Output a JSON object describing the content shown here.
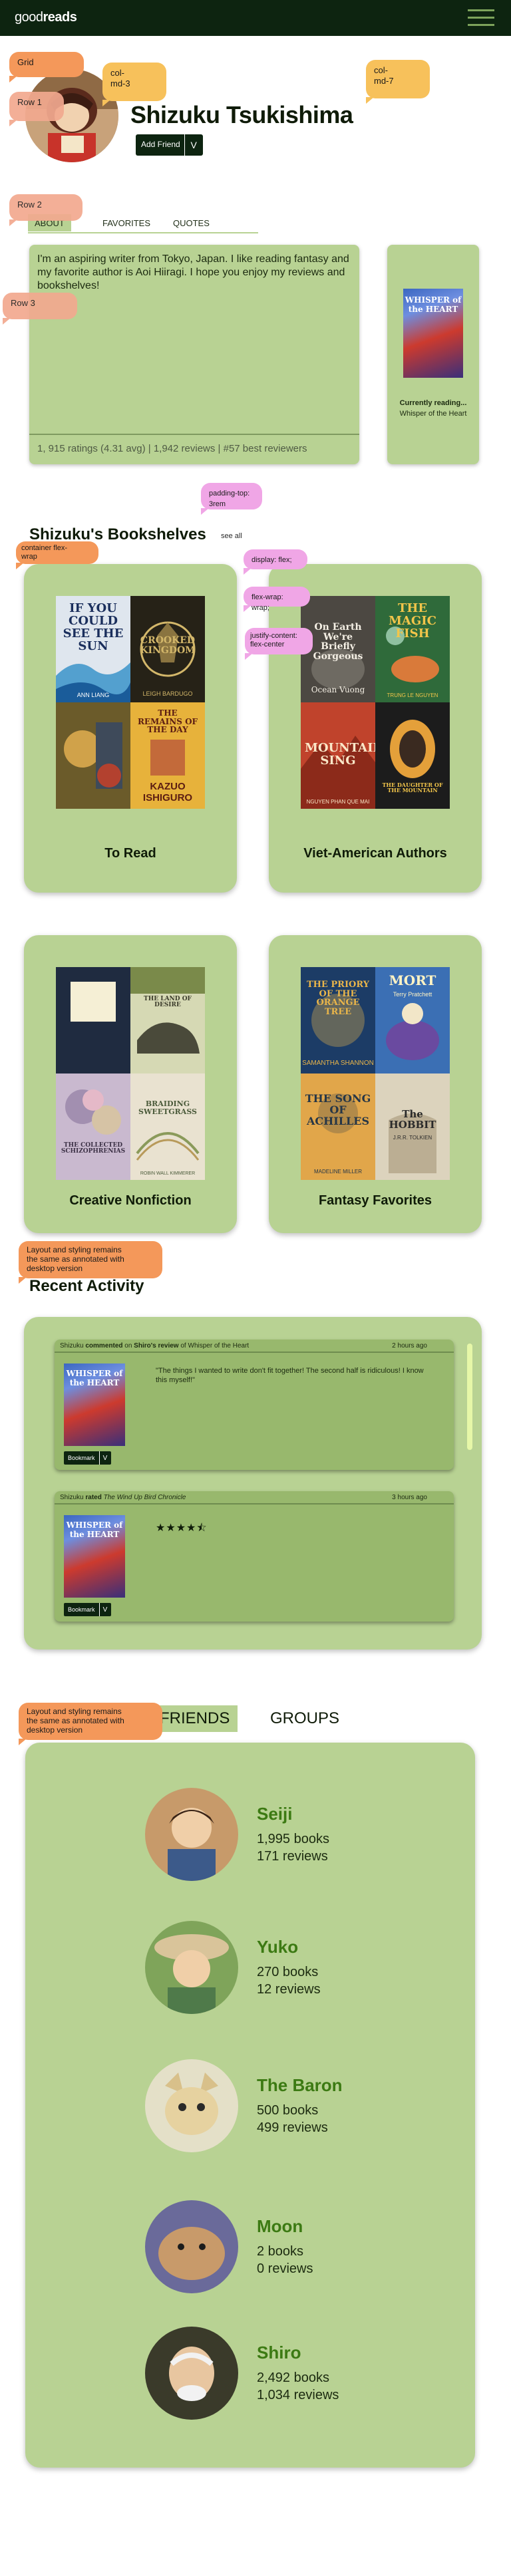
{
  "nav": {
    "logo_regular": "good",
    "logo_bold": "reads"
  },
  "notes": {
    "grid": "Grid",
    "row1": "Row 1",
    "col_md_3": "col-\nmd-3",
    "col_md_7": "col-\nmd-7",
    "row2": "Row 2",
    "row3": "Row 3",
    "padding_top": "padding-top:\n3rem",
    "container_flex_wrap": "container flex-\nwrap",
    "display_flex": "display: flex;",
    "flex_wrap": "flex-wrap: wrap;",
    "justify_content": "justify-content:\nflex-center",
    "layout_same_1": "Layout and styling remains\nthe same as annotated with\ndesktop version",
    "layout_same_2": "Layout and styling remains\nthe same as annotated with\ndesktop version"
  },
  "profile": {
    "name": "Shizuku Tsukishima",
    "add_friend": "Add Friend",
    "add_friend_chevron": "V",
    "tabs": [
      "ABOUT",
      "FAVORITES",
      "QUOTES"
    ],
    "about": "I'm an aspiring writer from Tokyo, Japan. I like reading fantasy and my favorite author is Aoi Hiiragi. I hope you enjoy my reviews and bookshelves!",
    "stats": "1, 915 ratings (4.31 avg)  |  1,942 reviews  |  #57 best reviewers",
    "currently_reading_label": "Currently reading...",
    "currently_reading_title": "Whisper of the Heart",
    "cover_text": "WHISPER of the HEART"
  },
  "bookshelves": {
    "title": "Shizuku's Bookshelves",
    "see_all": "see all",
    "shelves": [
      {
        "name": "To Read",
        "books": [
          {
            "title": "IF YOU COULD SEE THE SUN",
            "author": "ANN LIANG",
            "bg": "#dfe6ee",
            "fg": "#1a2e5c"
          },
          {
            "title": "CROOKED KINGDOM",
            "author": "LEIGH BARDUGO",
            "bg": "#262217",
            "fg": "#d3b76a"
          },
          {
            "title": "",
            "author": "",
            "bg": "#7a6a38",
            "fg": "#f1d89a"
          },
          {
            "title": "THE REMAINS OF THE DAY",
            "author": "KAZUO ISHIGURO",
            "bg": "#e7b23b",
            "fg": "#5c1d12"
          }
        ]
      },
      {
        "name": "Viet-American Authors",
        "books": [
          {
            "title": "On Earth We're Briefly Gorgeous",
            "author": "Ocean Vuong",
            "bg": "#5f5a52",
            "fg": "#f4efe4"
          },
          {
            "title": "THE MAGIC FISH",
            "author": "TRUNG LE NGUYEN",
            "bg": "#2f6a3a",
            "fg": "#f2c54a"
          },
          {
            "title": "MOUNTAINS SING",
            "author": "NGUYEN PHAN QUE MAI",
            "bg": "#c0432c",
            "fg": "#fbe7c8"
          },
          {
            "title": "THE DAUGHTER OF THE MOUNTAIN",
            "author": "",
            "bg": "#e4a03a",
            "fg": "#2a1a10"
          }
        ]
      },
      {
        "name": "Creative Nonfiction",
        "books": [
          {
            "title": "",
            "author": "",
            "bg": "#1f2b40",
            "fg": "#f5efd5"
          },
          {
            "title": "THE LAND OF DESIRE",
            "author": "",
            "bg": "#d6d9b4",
            "fg": "#3a3a2a"
          },
          {
            "title": "THE COLLECTED SCHIZOPHRENIAS",
            "author": "",
            "bg": "#c9b9cf",
            "fg": "#3a2f44"
          },
          {
            "title": "BRAIDING SWEETGRASS",
            "author": "ROBIN WALL KIMMERER",
            "bg": "#e9e2d0",
            "fg": "#4a5a3a"
          }
        ]
      },
      {
        "name": "Fantasy Favorites",
        "books": [
          {
            "title": "THE PRIORY OF THE ORANGE TREE",
            "author": "SAMANTHA SHANNON",
            "bg": "#1c3c66",
            "fg": "#e9b54a"
          },
          {
            "title": "MORT",
            "author": "Terry Pratchett",
            "bg": "#3b6fb4",
            "fg": "#fff3c4"
          },
          {
            "title": "THE SONG OF ACHILLES",
            "author": "MADELINE MILLER",
            "bg": "#e1a64a",
            "fg": "#263646"
          },
          {
            "title": "The HOBBIT",
            "author": "J.R.R. TOLKIEN",
            "bg": "#dcd3bd",
            "fg": "#2a2a2a"
          }
        ]
      }
    ]
  },
  "activity": {
    "title": "Recent Activity",
    "items": [
      {
        "user": "Shizuku",
        "verb": "commented",
        "on": "on",
        "review_of": "Shiro's review",
        "of_word": "of",
        "book": "Whisper of the Heart",
        "time": "2 hours ago",
        "quote": "\"The things I wanted to write don't fit together! The second half is ridiculous! I know this myself!\""
      },
      {
        "user": "Shizuku",
        "verb": "rated",
        "book": "The Wind Up Bird Chronicle",
        "time": "3 hours ago",
        "stars": "★★★★⯪"
      }
    ],
    "bookmark": "Bookmark",
    "bookmark_chevron": "V"
  },
  "friends": {
    "tabs": [
      "FRIENDS",
      "GROUPS"
    ],
    "list": [
      {
        "name": "Seiji",
        "books": "1,995 books",
        "reviews": "171 reviews"
      },
      {
        "name": "Yuko",
        "books": "270 books",
        "reviews": "12 reviews"
      },
      {
        "name": "The Baron",
        "books": "500 books",
        "reviews": "499 reviews"
      },
      {
        "name": "Moon",
        "books": "2 books",
        "reviews": "0 reviews"
      },
      {
        "name": "Shiro",
        "books": "2,492 books",
        "reviews": "1,034 reviews"
      }
    ]
  },
  "colors": {
    "nav": "#0d2410",
    "card": "#b8d293",
    "accent_green": "#3c7a13",
    "note_orange": "#f4985a",
    "note_yellow": "#f7c15b",
    "note_pink": "#f0a6e6"
  }
}
